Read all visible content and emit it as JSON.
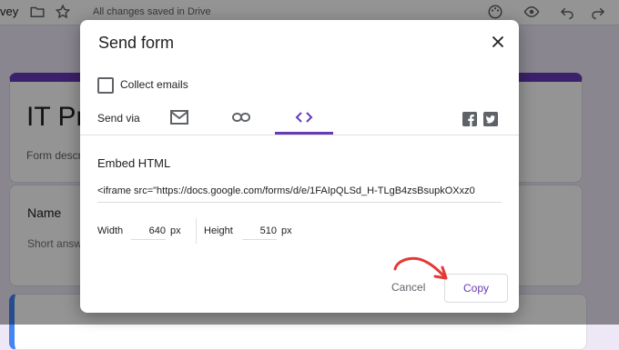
{
  "app": {
    "doc_name_fragment": "vey",
    "saved_status": "All changes saved in Drive",
    "form_title_fragment": "IT Pro",
    "form_desc_fragment": "Form descr",
    "question_label": "Name",
    "question_placeholder_fragment": "Short answ"
  },
  "dialog": {
    "title": "Send form",
    "collect_emails_label": "Collect emails",
    "collect_emails_checked": false,
    "send_via_label": "Send via",
    "send_methods": [
      {
        "icon": "email-icon",
        "selected": false
      },
      {
        "icon": "link-icon",
        "selected": false
      },
      {
        "icon": "embed-code-icon",
        "selected": true
      }
    ],
    "social_icons": [
      "facebook-icon",
      "twitter-icon"
    ],
    "embed_heading": "Embed HTML",
    "embed_code": "<iframe src=\"https://docs.google.com/forms/d/e/1FAIpQLSd_H-TLgB4zsBsupkOXxz0",
    "width_label": "Width",
    "width_value": "640",
    "height_label": "Height",
    "height_value": "510",
    "unit": "px",
    "cancel_label": "Cancel",
    "copy_label": "Copy"
  },
  "colors": {
    "accent": "#673ab7",
    "annotation_arrow": "#e53935"
  }
}
